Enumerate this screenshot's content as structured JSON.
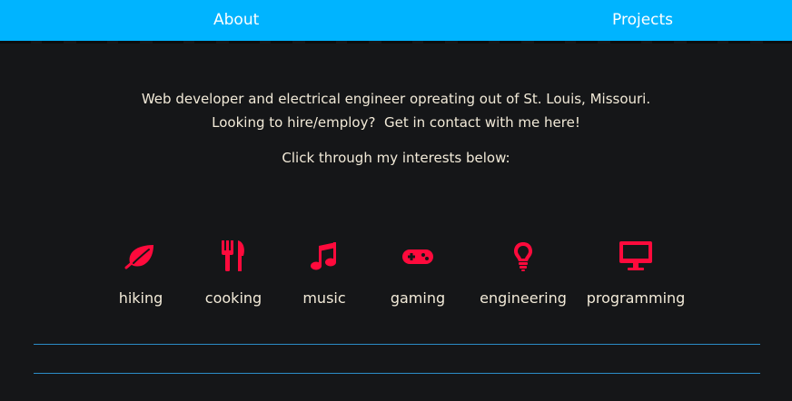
{
  "nav": {
    "about_label": "About",
    "projects_label": "Projects",
    "bg_color": "#00b4ff"
  },
  "intro": {
    "line1": "Web developer and electrical engineer opreating out of St. Louis, Missouri.",
    "line2_prefix": "Looking to hire/employ?",
    "line2_link": "Get in contact with me here!"
  },
  "prompt": "Click through my interests below:",
  "interests": [
    {
      "label": "hiking",
      "icon": "leaf-icon"
    },
    {
      "label": "cooking",
      "icon": "fork-knife-icon"
    },
    {
      "label": "music",
      "icon": "music-note-icon"
    },
    {
      "label": "gaming",
      "icon": "gamepad-icon"
    },
    {
      "label": "engineering",
      "icon": "lightbulb-icon"
    },
    {
      "label": "programming",
      "icon": "monitor-icon"
    }
  ],
  "colors": {
    "background": "#151618",
    "text": "#f2ead8",
    "icon": "#ff0a3c",
    "rule": "#2b8cc7"
  }
}
